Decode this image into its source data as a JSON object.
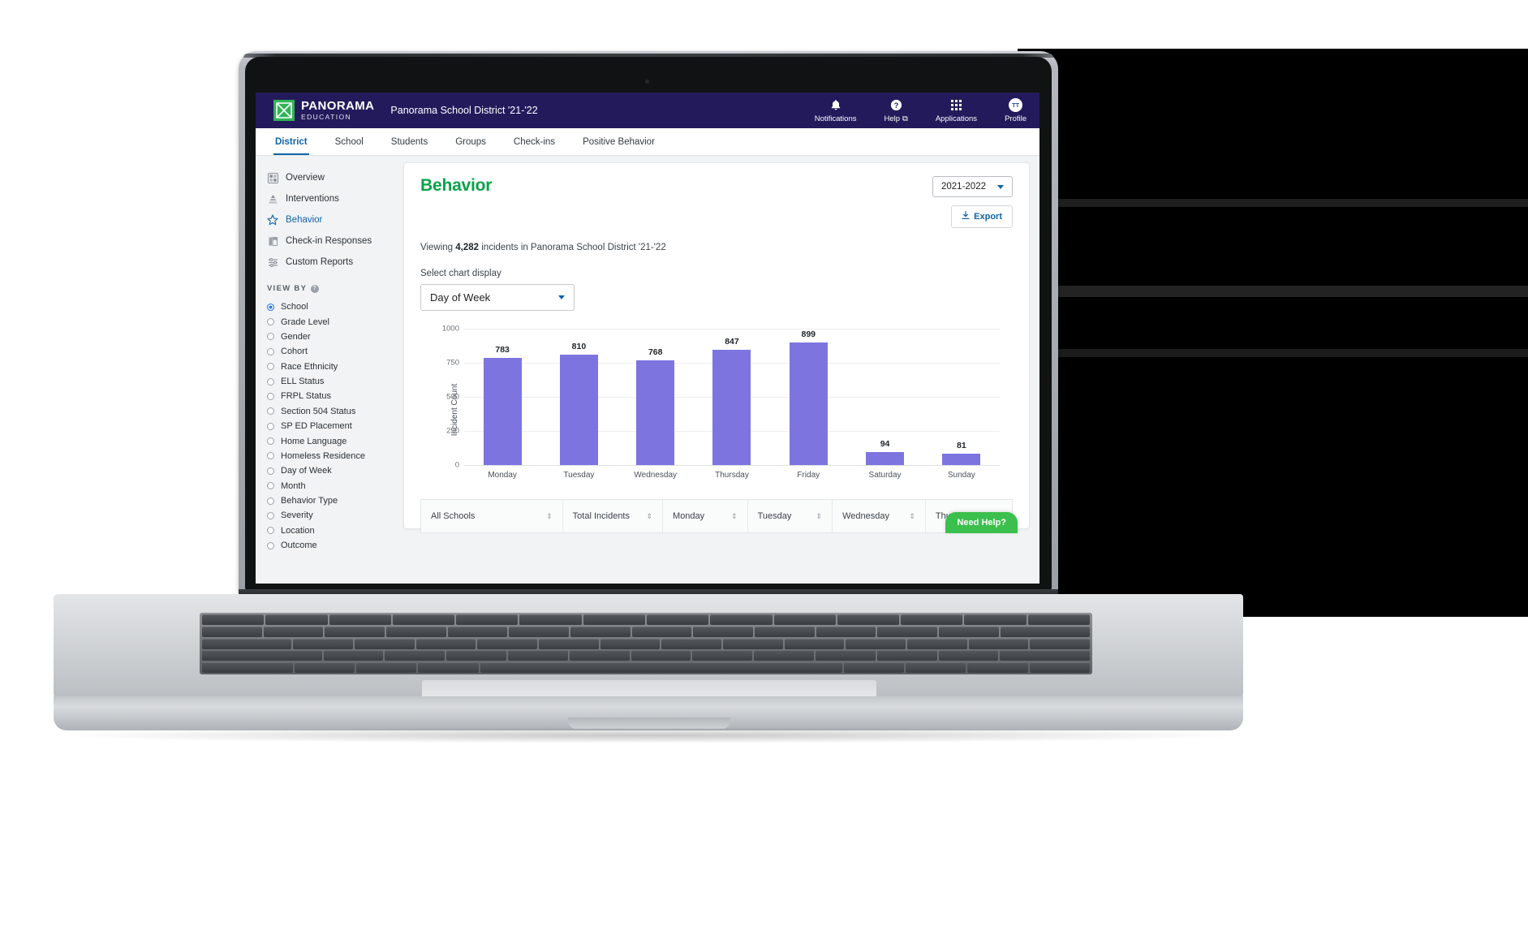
{
  "brand": {
    "name": "PANORAMA",
    "sub": "EDUCATION",
    "logo_color": "#2fb457",
    "district": "Panorama School District '21-'22"
  },
  "topnav": [
    {
      "label": "Notifications",
      "icon": "bell-icon"
    },
    {
      "label": "Help",
      "icon": "question-circle-icon",
      "external": "⧉"
    },
    {
      "label": "Applications",
      "icon": "grid-icon"
    },
    {
      "label": "Profile",
      "icon": "avatar-icon",
      "initials": "TT"
    }
  ],
  "tabs": [
    {
      "label": "District",
      "active": true
    },
    {
      "label": "School",
      "active": false
    },
    {
      "label": "Students",
      "active": false
    },
    {
      "label": "Groups",
      "active": false
    },
    {
      "label": "Check-ins",
      "active": false
    },
    {
      "label": "Positive Behavior",
      "active": false
    }
  ],
  "sidebar": {
    "items": [
      {
        "label": "Overview",
        "icon": "dashboard-icon",
        "active": false
      },
      {
        "label": "Interventions",
        "icon": "pyramid-icon",
        "active": false
      },
      {
        "label": "Behavior",
        "icon": "star-icon",
        "active": true
      },
      {
        "label": "Check-in Responses",
        "icon": "book-icon",
        "active": false
      },
      {
        "label": "Custom Reports",
        "icon": "sliders-icon",
        "active": false
      }
    ],
    "viewby_header": "VIEW BY",
    "viewby_help_icon": "help-circle-icon",
    "viewby_options": [
      {
        "label": "School",
        "selected": true
      },
      {
        "label": "Grade Level",
        "selected": false
      },
      {
        "label": "Gender",
        "selected": false
      },
      {
        "label": "Cohort",
        "selected": false
      },
      {
        "label": "Race Ethnicity",
        "selected": false
      },
      {
        "label": "ELL Status",
        "selected": false
      },
      {
        "label": "FRPL Status",
        "selected": false
      },
      {
        "label": "Section 504 Status",
        "selected": false
      },
      {
        "label": "SP ED Placement",
        "selected": false
      },
      {
        "label": "Home Language",
        "selected": false
      },
      {
        "label": "Homeless Residence",
        "selected": false
      },
      {
        "label": "Day of Week",
        "selected": false
      },
      {
        "label": "Month",
        "selected": false
      },
      {
        "label": "Behavior Type",
        "selected": false
      },
      {
        "label": "Severity",
        "selected": false
      },
      {
        "label": "Location",
        "selected": false
      },
      {
        "label": "Outcome",
        "selected": false
      }
    ]
  },
  "main": {
    "title": "Behavior",
    "title_color": "#0aa34a",
    "year_select": "2021-2022",
    "export_label": "Export",
    "export_icon": "download-icon",
    "viewing_prefix": "Viewing ",
    "viewing_count": "4,282",
    "viewing_suffix": " incidents in Panorama School District '21-'22",
    "chart_display_label": "Select chart display",
    "chart_display_value": "Day of Week"
  },
  "table": {
    "columns": [
      {
        "label": "All Schools",
        "sortable": true
      },
      {
        "label": "Total Incidents",
        "sortable": true
      },
      {
        "label": "Monday",
        "sortable": true
      },
      {
        "label": "Tuesday",
        "sortable": true
      },
      {
        "label": "Wednesday",
        "sortable": true
      },
      {
        "label": "Thursday",
        "sortable": true
      }
    ]
  },
  "need_help": {
    "label": "Need Help?",
    "color": "#3bbf4d"
  },
  "chart_data": {
    "type": "bar",
    "title": "",
    "xlabel": "",
    "ylabel": "Incident Count",
    "categories": [
      "Monday",
      "Tuesday",
      "Wednesday",
      "Thursday",
      "Friday",
      "Saturday",
      "Sunday"
    ],
    "values": [
      783,
      810,
      768,
      847,
      899,
      94,
      81
    ],
    "ylim": [
      0,
      1000
    ],
    "yticks": [
      0,
      250,
      500,
      750,
      1000
    ],
    "grid": true,
    "legend": "none",
    "bar_color": "#7e74e0",
    "data_labels": true
  }
}
